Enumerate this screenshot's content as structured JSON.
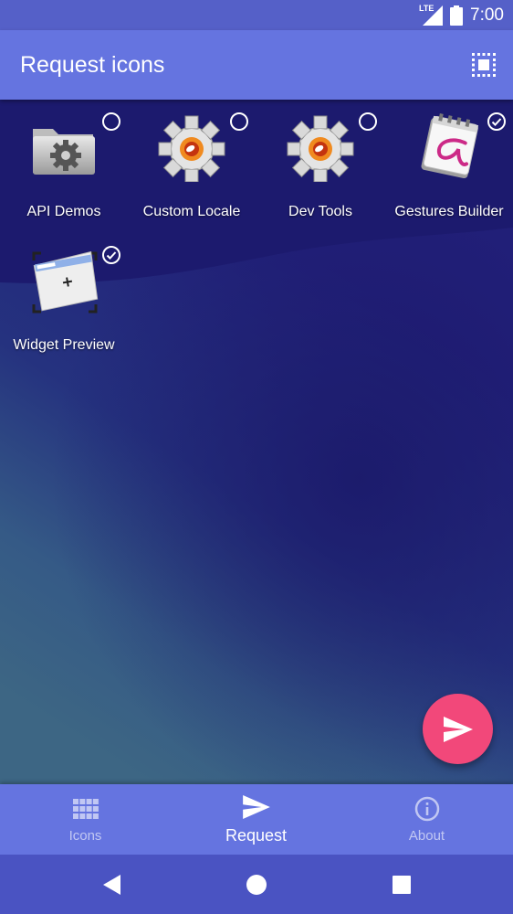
{
  "status_bar": {
    "time": "7:00",
    "network_label": "LTE",
    "icons": [
      "lte-signal-icon",
      "battery-icon"
    ]
  },
  "app_bar": {
    "title": "Request icons",
    "action_icon": "select-all-icon"
  },
  "apps": [
    {
      "label": "API Demos",
      "icon": "folder-gear-icon",
      "selected": false
    },
    {
      "label": "Custom Locale",
      "icon": "gear-icon",
      "selected": false
    },
    {
      "label": "Dev Tools",
      "icon": "gear-icon",
      "selected": false
    },
    {
      "label": "Gestures Builder",
      "icon": "gestures-icon",
      "selected": true
    },
    {
      "label": "Widget Preview",
      "icon": "widget-preview-icon",
      "selected": true
    }
  ],
  "fab": {
    "icon": "send-icon"
  },
  "bottom_nav": {
    "items": [
      {
        "label": "Icons",
        "icon": "grid-icon",
        "active": false
      },
      {
        "label": "Request",
        "icon": "send-icon",
        "active": true
      },
      {
        "label": "About",
        "icon": "info-icon",
        "active": false
      }
    ]
  },
  "system_nav": {
    "icons": [
      "back-icon",
      "home-icon",
      "recents-icon"
    ]
  },
  "colors": {
    "status_bar": "#5560c8",
    "app_bar": "#6574e0",
    "fab": "#f2487a",
    "system_nav": "#4a53c2"
  }
}
